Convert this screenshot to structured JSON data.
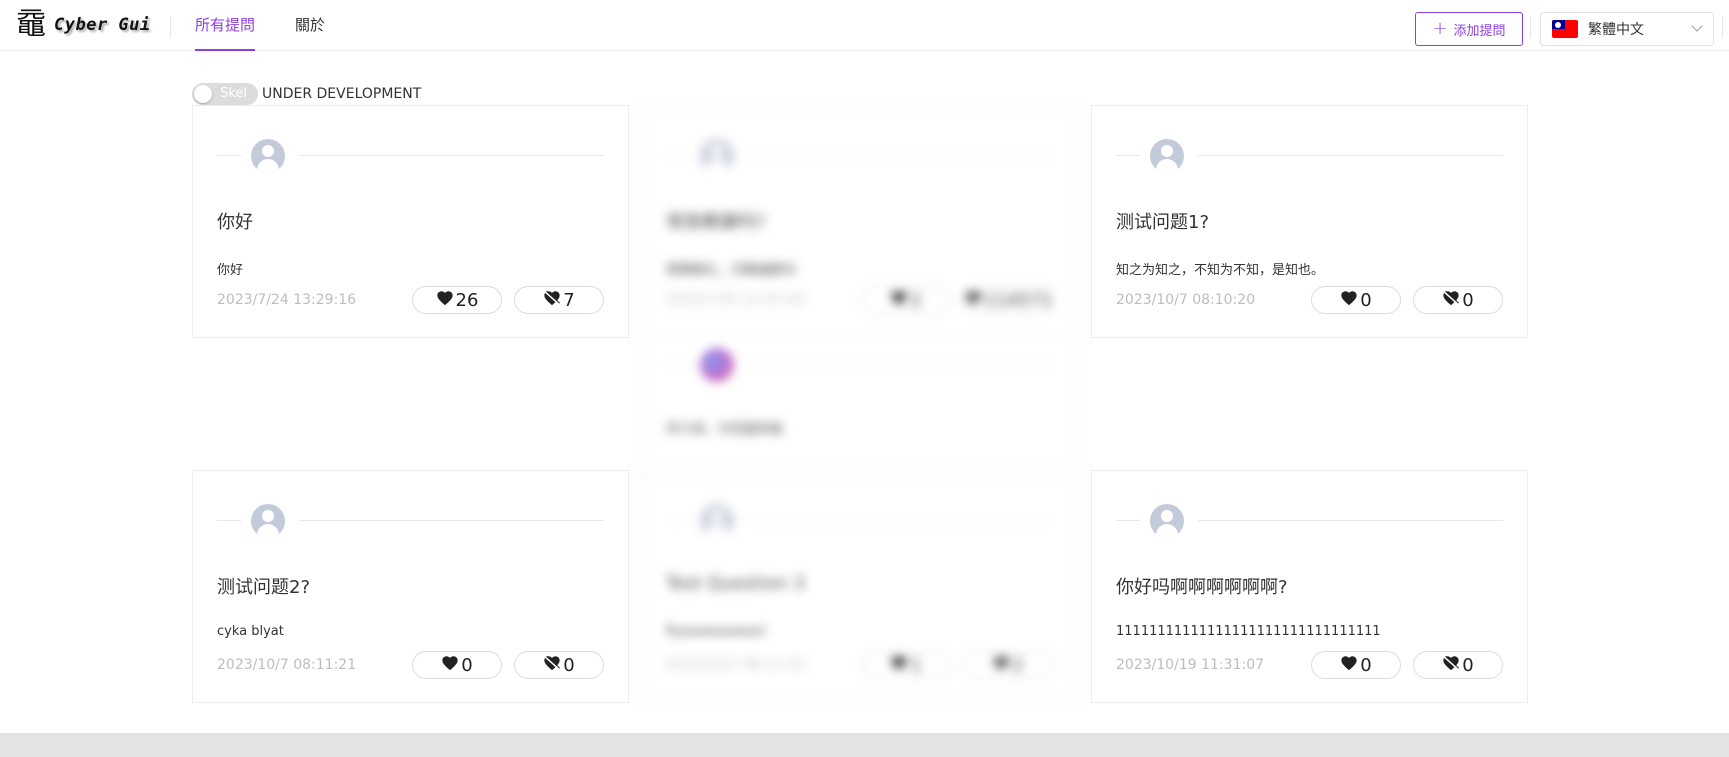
{
  "app": {
    "logo_glyph": "黿",
    "name": "Cyber Gui"
  },
  "nav": {
    "tabs": [
      {
        "label": "所有提問",
        "active": true
      },
      {
        "label": "關於",
        "active": false
      }
    ]
  },
  "header": {
    "add_button_label": "添加提問",
    "add_button_icon": "plus-icon",
    "language": {
      "selected": "繁體中文",
      "flag": "taiwan-flag-icon"
    }
  },
  "toggle": {
    "label": "Skel",
    "on": false,
    "status_text": "UNDER DEVELOPMENT"
  },
  "colors": {
    "accent": "#8e3fe0",
    "date_text": "#bdbdbd",
    "card_border": "#eeeeee",
    "footer": "#e3e3e3"
  },
  "cards": [
    {
      "title": "你好",
      "body": "你好",
      "date": "2023/7/24 13:29:16",
      "likes": "26",
      "dislikes": "7",
      "blurred": false
    },
    {
      "title": "常旅教鑄吗?",
      "body": "情賣搬孔，切鑄遍鑄句",
      "date": "2023/7/25 15:03:44",
      "likes": "2",
      "dislikes": "114571",
      "blurred": true
    },
    {
      "title": "测试问题1?",
      "body": "知之为知之，不知为不知，是知也。",
      "date": "2023/10/7 08:10:20",
      "likes": "0",
      "dislikes": "0",
      "blurred": false
    },
    {
      "title": "测试问题2?",
      "body": "cyka blyat",
      "date": "2023/10/7 08:11:21",
      "likes": "0",
      "dislikes": "0",
      "blurred": false
    },
    {
      "title": "Test Question 3",
      "body": "Ryaaaaaaaaaa!",
      "date": "2023/10/7 08:11:53",
      "likes": "1",
      "dislikes": "2",
      "blurred": true
    },
    {
      "title": "你好吗啊啊啊啊啊啊?",
      "body": "11111111111111111111111111111111",
      "date": "2023/10/19 11:31:07",
      "likes": "0",
      "dislikes": "0",
      "blurred": false
    }
  ],
  "extra_reply": {
    "text": "并介绍，示回鉴辞鉴"
  }
}
